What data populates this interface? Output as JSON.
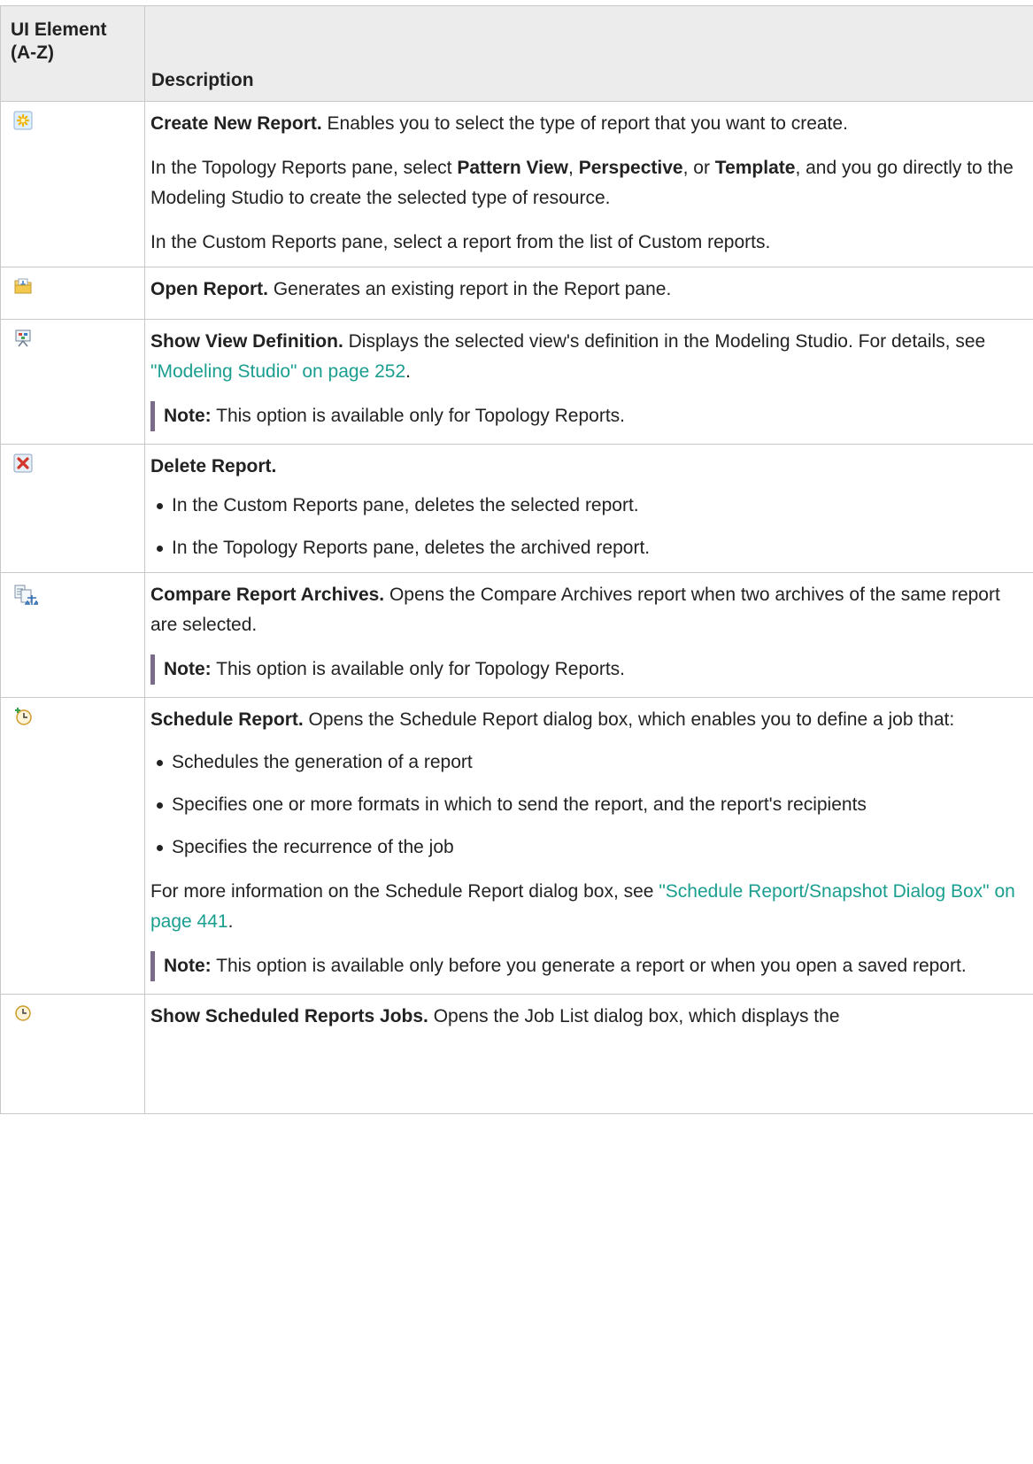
{
  "header": {
    "col1": "UI Element (A-Z)",
    "col2": "Description"
  },
  "rows": {
    "create": {
      "icon": "create-new-report-icon",
      "title": "Create New Report.",
      "text": " Enables you to select the type of report that you want to create.",
      "p2_a": "In the Topology Reports pane, select ",
      "p2_b1": "Pattern View",
      "p2_sep1": ", ",
      "p2_b2": "Perspective",
      "p2_sep2": ", or ",
      "p2_b3": "Template",
      "p2_c": ", and you go directly to the Modeling Studio to create the selected type of resource.",
      "p3": "In the Custom Reports pane, select a report from the list of Custom reports."
    },
    "open": {
      "icon": "open-report-icon",
      "title": "Open Report.",
      "text": " Generates an existing report in the Report pane."
    },
    "showview": {
      "icon": "show-view-definition-icon",
      "title": "Show View Definition.",
      "text": " Displays the selected view's definition in the Modeling Studio. For details, see ",
      "link": "\"Modeling Studio\" on page 252",
      "after": ".",
      "note_label": "Note:",
      "note_text": "  This option is available only for Topology Reports."
    },
    "delete": {
      "icon": "delete-report-icon",
      "title": "Delete Report.",
      "bullets": [
        "In the Custom Reports pane, deletes the selected report.",
        "In the Topology Reports pane, deletes the archived report."
      ]
    },
    "compare": {
      "icon": "compare-report-archives-icon",
      "title": "Compare Report Archives.",
      "text": " Opens the Compare Archives report when two archives of the same report are selected.",
      "note_label": "Note:",
      "note_text": "  This option is available only for Topology Reports."
    },
    "schedule": {
      "icon": "schedule-report-icon",
      "title": "Schedule Report.",
      "text": " Opens the Schedule Report dialog box, which enables you to define a job that:",
      "bullets": [
        "Schedules the generation of a report",
        "Specifies one or more formats in which to send the report, and the report's recipients",
        "Specifies the recurrence of the job"
      ],
      "more_a": "For more information on the Schedule Report dialog box, see ",
      "link": "\"Schedule Report/Snapshot Dialog Box\" on page 441",
      "after": ".",
      "note_label": "Note:",
      "note_text": "  This option is available only before you generate a report or when you open a saved report."
    },
    "jobs": {
      "icon": "show-scheduled-reports-jobs-icon",
      "title": "Show Scheduled Reports Jobs.",
      "text": " Opens the Job List dialog box, which displays the"
    }
  }
}
